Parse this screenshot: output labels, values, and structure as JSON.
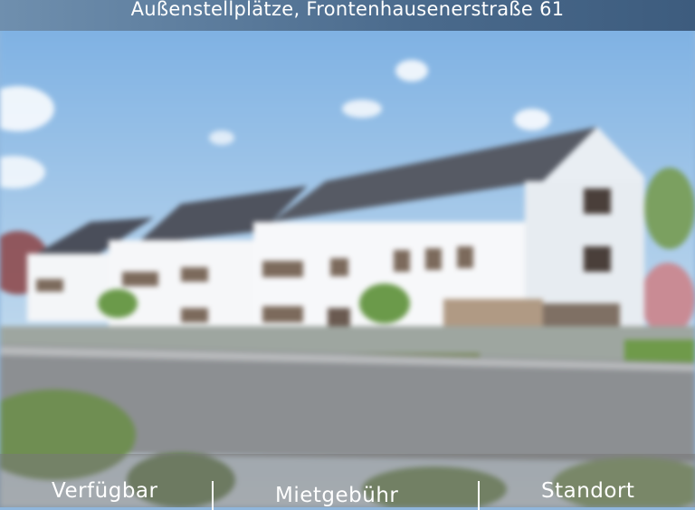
{
  "header": {
    "title": "Außenstellplätze, Frontenhausenerstraße 61"
  },
  "image": {
    "icon": "building-rendering-image"
  },
  "tabs": [
    {
      "label": "Verfügbar"
    },
    {
      "label": "Mietgebühr"
    },
    {
      "label": "Standort"
    }
  ],
  "colors": {
    "header_bar": "#4a6a8c",
    "tab_bar": "#787878",
    "text": "#ffffff"
  }
}
